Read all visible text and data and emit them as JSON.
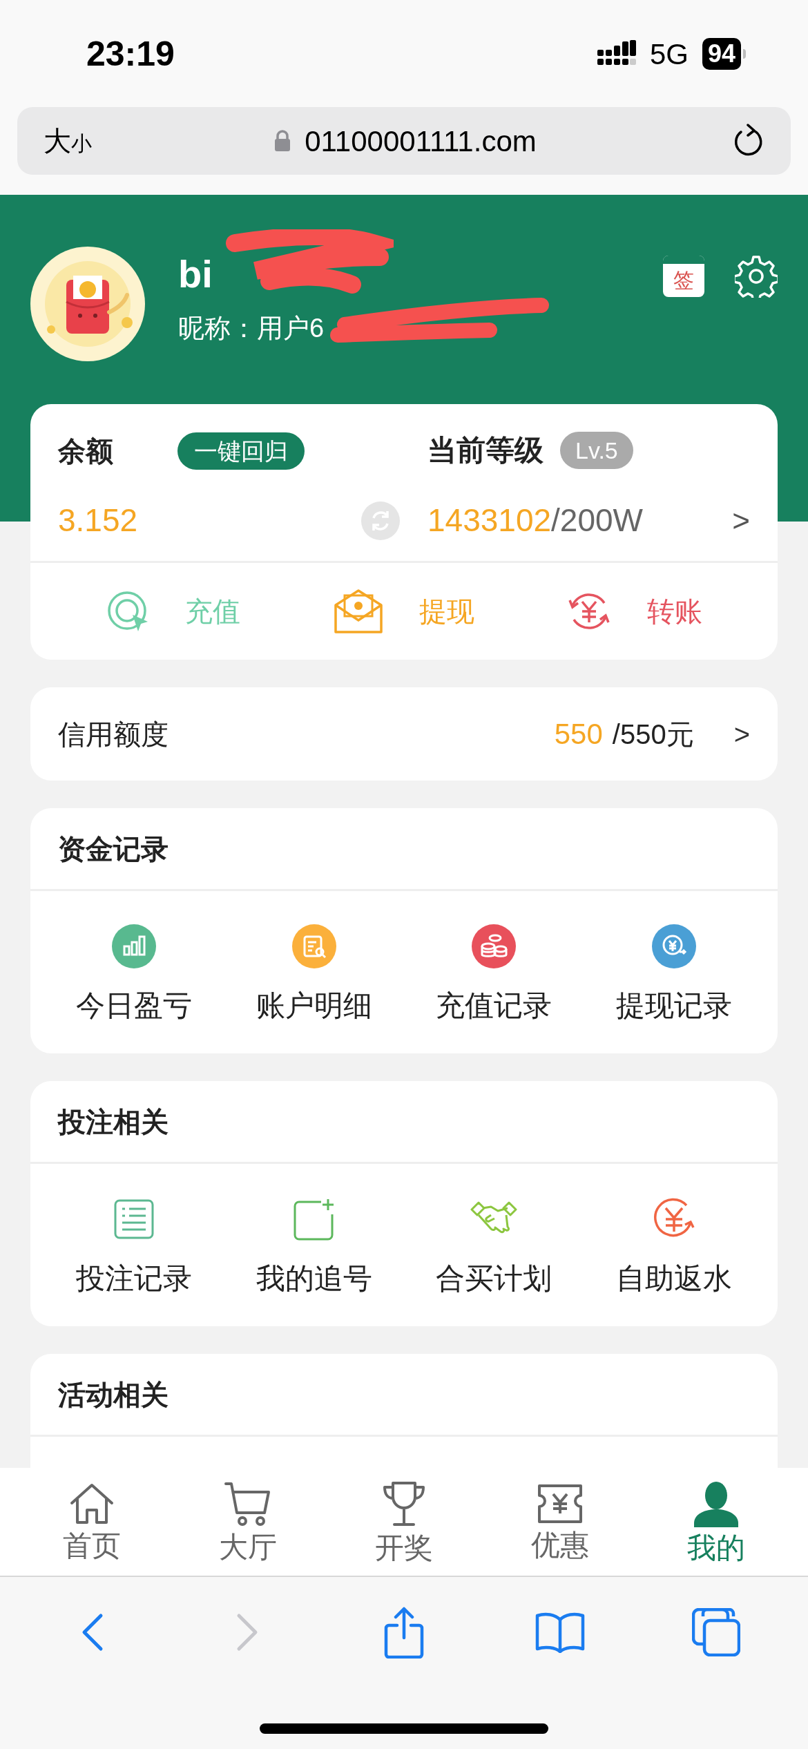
{
  "status_bar": {
    "time": "23:19",
    "network": "5G",
    "battery": "94"
  },
  "browser": {
    "reader_button": {
      "large": "大",
      "small": "小"
    },
    "url": "01100001111.com"
  },
  "profile": {
    "name": "bi",
    "nickname": "昵称：用户6",
    "sign_in_icon": "签"
  },
  "account_card": {
    "balance_label": "余额",
    "return_button": "一键回归",
    "level_label": "当前等级",
    "level_badge": "Lv.5",
    "balance": "3.152",
    "points": "1433102",
    "points_total": "/200W",
    "arrow": ">",
    "actions": [
      {
        "kind": "recharge",
        "label": "充值",
        "color": "#6fcfa7"
      },
      {
        "kind": "withdraw",
        "label": "提现",
        "color": "#f5a623"
      },
      {
        "kind": "transfer",
        "label": "转账",
        "color": "#e5545f"
      }
    ]
  },
  "credit": {
    "label": "信用额度",
    "used": "550",
    "total": "/550元",
    "arrow": ">"
  },
  "sections": [
    {
      "title": "资金记录",
      "items": [
        {
          "kind": "chart",
          "label": "今日盈亏",
          "color": "#58b98f"
        },
        {
          "kind": "doc",
          "label": "账户明细",
          "color": "#fbb03b"
        },
        {
          "kind": "coins",
          "label": "充值记录",
          "color": "#e8505b"
        },
        {
          "kind": "yen",
          "label": "提现记录",
          "color": "#4a9fd5"
        }
      ]
    },
    {
      "title": "投注相关",
      "items": [
        {
          "kind": "list",
          "label": "投注记录",
          "color": "#5cb891"
        },
        {
          "kind": "add",
          "label": "我的追号",
          "color": "#5cb85c"
        },
        {
          "kind": "handshake",
          "label": "合买计划",
          "color": "#8cc63f"
        },
        {
          "kind": "rebate",
          "label": "自助返水",
          "color": "#f06543"
        }
      ]
    },
    {
      "title": "活动相关"
    }
  ],
  "tabs": [
    {
      "kind": "home",
      "label": "首页",
      "selected": false
    },
    {
      "kind": "cart",
      "label": "大厅",
      "selected": false
    },
    {
      "kind": "trophy",
      "label": "开奖",
      "selected": false
    },
    {
      "kind": "ticket",
      "label": "优惠",
      "selected": false
    },
    {
      "kind": "user",
      "label": "我的",
      "selected": true
    }
  ],
  "toolbar": [
    {
      "kind": "back",
      "disabled": false
    },
    {
      "kind": "forward",
      "disabled": true
    },
    {
      "kind": "share",
      "disabled": false
    },
    {
      "kind": "bookmarks",
      "disabled": false
    },
    {
      "kind": "tabs",
      "disabled": false
    }
  ]
}
